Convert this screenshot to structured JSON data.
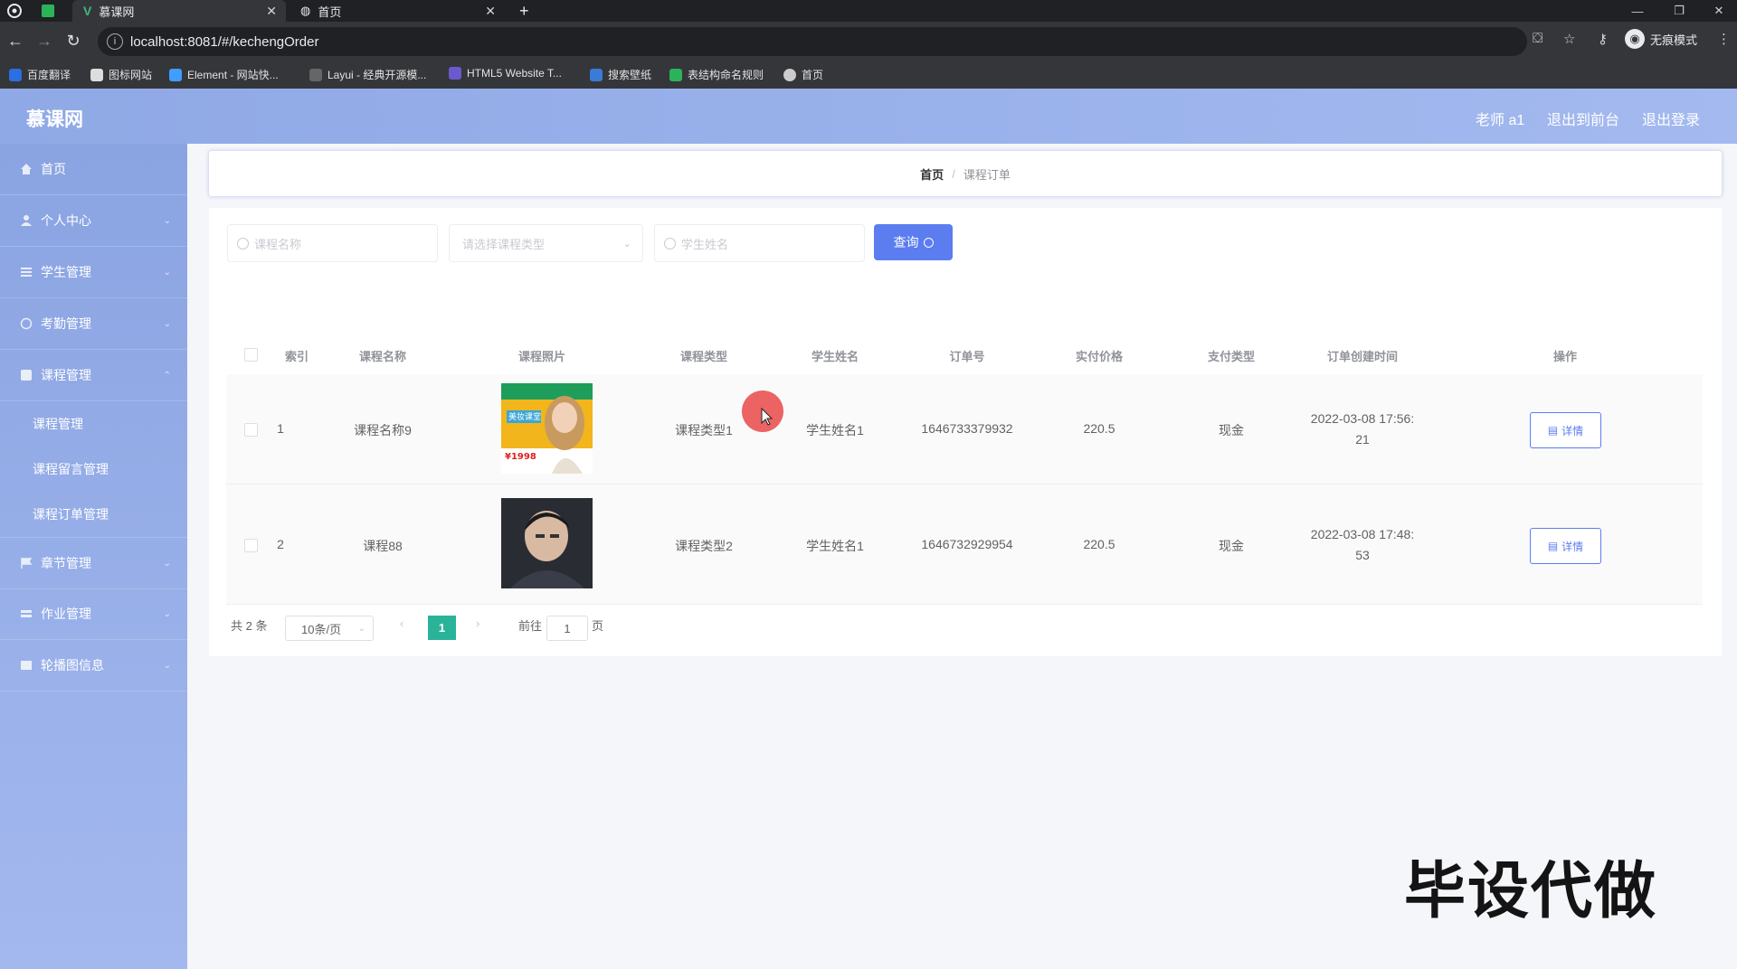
{
  "browser": {
    "tabs": [
      {
        "label": "慕课网"
      },
      {
        "label": "首页"
      }
    ],
    "new_tab": "+",
    "url": "localhost:8081/#/kechengOrder",
    "incognito": "无痕模式",
    "bookmarks": [
      {
        "label": "百度翻译"
      },
      {
        "label": "图标网站"
      },
      {
        "label": "Element - 网站快..."
      },
      {
        "label": "Layui - 经典开源模..."
      },
      {
        "label": "HTML5 Website T..."
      },
      {
        "label": "搜索壁纸"
      },
      {
        "label": "表结构命名规则"
      },
      {
        "label": "首页"
      }
    ]
  },
  "header": {
    "logo": "慕课网",
    "user": "老师 a1",
    "back_to_front": "退出到前台",
    "logout": "退出登录"
  },
  "sidebar": {
    "items": [
      {
        "label": "首页"
      },
      {
        "label": "个人中心"
      },
      {
        "label": "学生管理"
      },
      {
        "label": "考勤管理"
      },
      {
        "label": "课程管理"
      },
      {
        "label": "章节管理"
      },
      {
        "label": "作业管理"
      },
      {
        "label": "轮播图信息"
      }
    ],
    "sub_items": [
      {
        "label": "课程管理"
      },
      {
        "label": "课程留言管理"
      },
      {
        "label": "课程订单管理"
      }
    ]
  },
  "breadcrumb": {
    "home": "首页",
    "separator": "/",
    "current": "课程订单"
  },
  "search": {
    "course_name_placeholder": "课程名称",
    "course_type_placeholder": "请选择课程类型",
    "student_name_placeholder": "学生姓名",
    "query_label": "查询"
  },
  "table": {
    "headers": [
      "索引",
      "课程名称",
      "课程照片",
      "课程类型",
      "学生姓名",
      "订单号",
      "实付价格",
      "支付类型",
      "订单创建时间",
      "操作"
    ],
    "rows": [
      {
        "index": "1",
        "course_name": "课程名称9",
        "course_type": "课程类型1",
        "student_name": "学生姓名1",
        "order_no": "1646733379932",
        "price": "220.5",
        "pay_type": "现金",
        "created_1": "2022-03-08 17:56:",
        "created_2": "21",
        "action": "详情"
      },
      {
        "index": "2",
        "course_name": "课程88",
        "course_type": "课程类型2",
        "student_name": "学生姓名1",
        "order_no": "1646732929954",
        "price": "220.5",
        "pay_type": "现金",
        "created_1": "2022-03-08 17:48:",
        "created_2": "53",
        "action": "详情"
      }
    ]
  },
  "pagination": {
    "total": "共 2 条",
    "page_size": "10条/页",
    "current_page": "1",
    "goto_prefix": "前往",
    "goto_value": "1",
    "goto_suffix": "页"
  },
  "thumb1_text": {
    "title": "美妆课堂",
    "price": "¥1998"
  },
  "watermark": "毕设代做",
  "colors": {
    "accent": "#5b7df0",
    "sidebar": "#8aa4e2",
    "pager_active": "#2bb39a"
  }
}
